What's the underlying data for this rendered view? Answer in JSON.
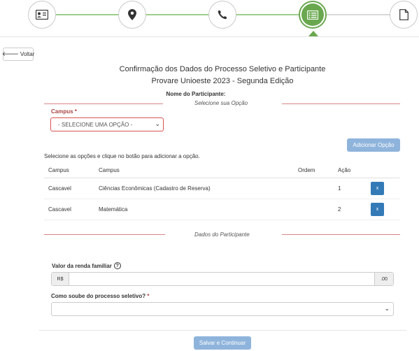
{
  "stepper": {
    "steps": [
      {
        "icon": "id-card-icon",
        "active": false
      },
      {
        "icon": "map-marker-icon",
        "active": false
      },
      {
        "icon": "phone-icon",
        "active": false
      },
      {
        "icon": "list-alt-icon",
        "active": true
      },
      {
        "icon": "file-icon",
        "active": false
      }
    ],
    "active_color": "#6aa84f"
  },
  "back_button": {
    "label": "Voltar",
    "icon": "arrow-left-icon"
  },
  "header": {
    "title": "Confirmação dos Dados do Processo Seletivo e Participante",
    "subtitle": "Provare Unioeste 2023 - Segunda Edição",
    "participant_label": "Nome do Participante:"
  },
  "options_section": {
    "title": "Selecione sua Opção",
    "campus_label": "Campus",
    "required_mark": "*",
    "campus_select_value": "- SELECIONE UMA OPÇÃO -",
    "add_button": "Adicionar Opção",
    "hint": "Selecione as opções e clique no botão para adicionar a opção.",
    "table": {
      "headers": [
        "Campus",
        "Campus",
        "Ordem",
        "Ação"
      ],
      "rows": [
        {
          "campus": "Cascavel",
          "course": "Ciências Econômicas (Cadastro de Reserva)",
          "order": "",
          "action_value": "1",
          "delete": "x"
        },
        {
          "campus": "Cascavel",
          "course": "Matemática",
          "order": "",
          "action_value": "2",
          "delete": "x"
        }
      ]
    }
  },
  "participant_section": {
    "title": "Dados do Participante",
    "income_label": "Valor da renda familiar",
    "help_icon": "?",
    "currency_prefix": "R$",
    "currency_suffix": ".00",
    "income_value": "",
    "how_label": "Como soube do processo seletivo?",
    "required_mark": "*",
    "how_value": ""
  },
  "save_button": "Salvar e Continuar",
  "colors": {
    "primary": "#337ab7",
    "primary_disabled": "#8fb4dc",
    "error": "#a94442",
    "success": "#6aa84f"
  }
}
